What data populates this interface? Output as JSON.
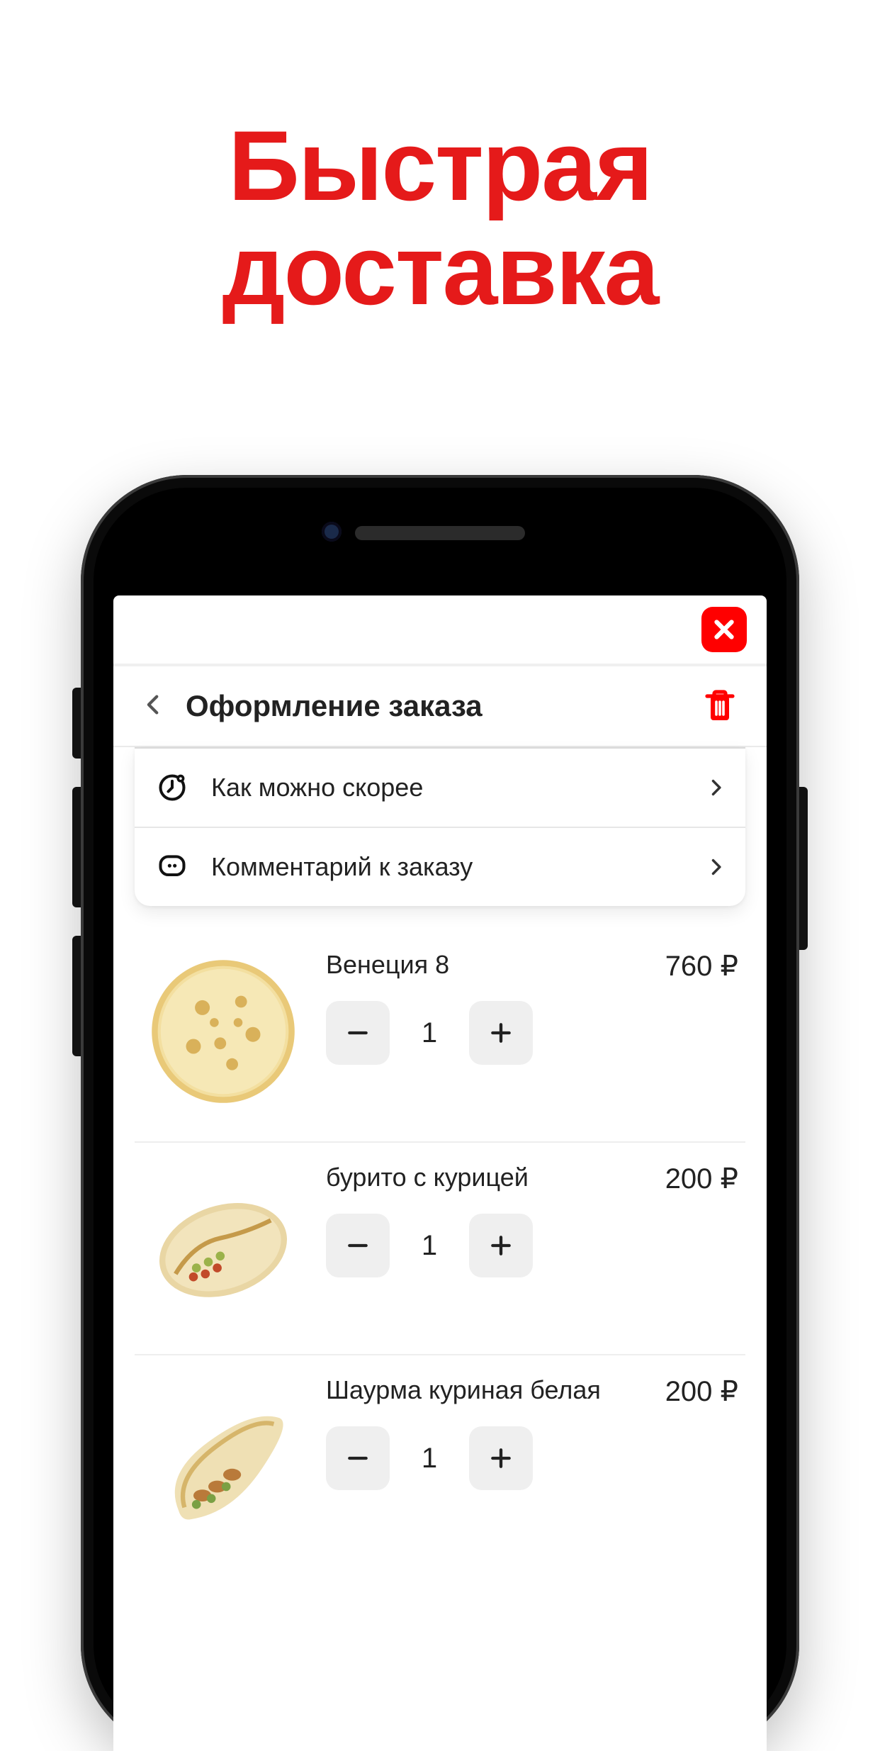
{
  "hero": {
    "line1": "Быстрая",
    "line2": "доставка"
  },
  "topbar": {
    "close_icon": "close"
  },
  "header": {
    "title": "Оформление заказа"
  },
  "options": [
    {
      "icon": "clock",
      "label": "Как можно скорее"
    },
    {
      "icon": "chat",
      "label": "Комментарий к заказу"
    }
  ],
  "currency": "₽",
  "items": [
    {
      "name": "Венеция 8",
      "qty": 1,
      "price": "760 ₽",
      "thumb": "pizza"
    },
    {
      "name": "бурито с курицей",
      "qty": 1,
      "price": "200 ₽",
      "thumb": "burrito"
    },
    {
      "name": "Шаурма куриная белая",
      "qty": 1,
      "price": "200 ₽",
      "thumb": "wrap"
    }
  ]
}
